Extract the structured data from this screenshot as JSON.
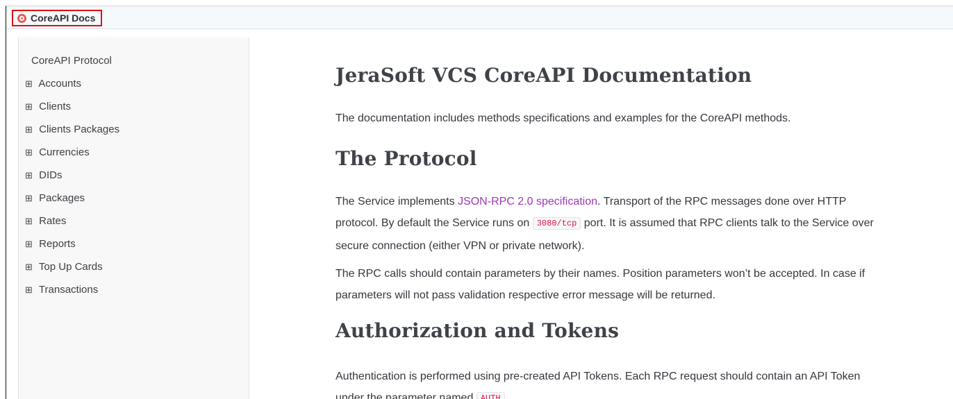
{
  "header": {
    "title": "CoreAPI Docs",
    "brand_color": "#e95a55",
    "highlight_border": "#e01010"
  },
  "sidebar": {
    "root": "CoreAPI Protocol",
    "expander_glyph": "⊞",
    "items": [
      {
        "label": "Accounts"
      },
      {
        "label": "Clients"
      },
      {
        "label": "Clients Packages"
      },
      {
        "label": "Currencies"
      },
      {
        "label": "DIDs"
      },
      {
        "label": "Packages"
      },
      {
        "label": "Rates"
      },
      {
        "label": "Reports"
      },
      {
        "label": "Top Up Cards"
      },
      {
        "label": "Transactions"
      }
    ]
  },
  "content": {
    "title": "JeraSoft VCS CoreAPI Documentation",
    "intro": "The documentation includes methods specifications and examples for the CoreAPI methods.",
    "protocol": {
      "heading": "The Protocol",
      "p1_prefix": "The Service implements ",
      "p1_link": "JSON-RPC 2.0 specification",
      "p1_mid": ". Transport of the RPC messages done over HTTP protocol. By default the Service runs on ",
      "p1_code": "3080/tcp",
      "p1_suffix": " port. It is assumed that RPC clients talk to the Service over secure connection (either VPN or private network).",
      "p2": "The RPC calls should contain parameters by their names. Position parameters won’t be accepted. In case if parameters will not pass validation respective error message will be returned."
    },
    "auth": {
      "heading": "Authorization and Tokens",
      "p1_prefix": "Authentication is performed using pre-created API Tokens. Each RPC request should contain an API Token under the parameter named ",
      "p1_code": "AUTH",
      "p1_suffix": "."
    }
  }
}
